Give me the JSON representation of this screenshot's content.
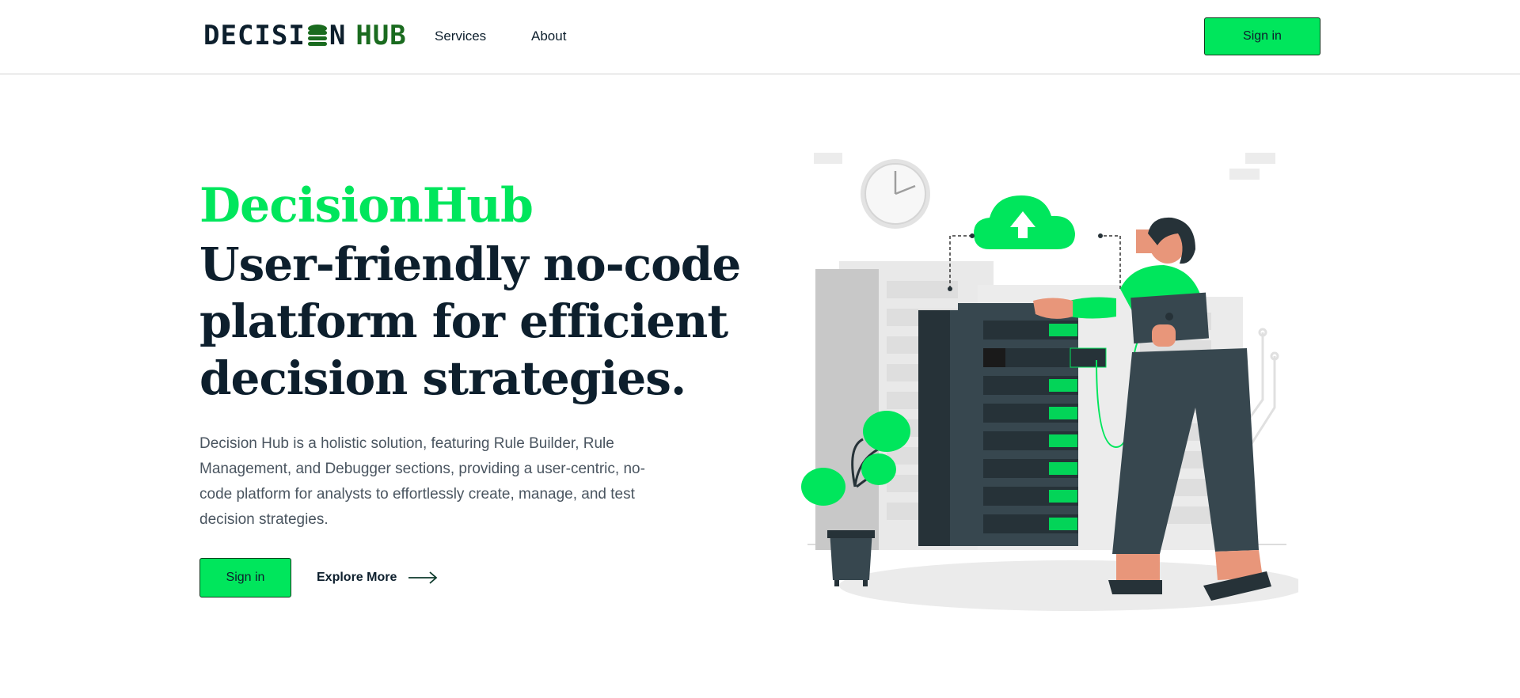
{
  "header": {
    "logo": {
      "part1": "DECISI",
      "part2": "N",
      "part3": "HUB"
    },
    "nav": {
      "services": "Services",
      "about": "About"
    },
    "sign_in": "Sign in"
  },
  "hero": {
    "brand": "DecisionHub",
    "title_lines": [
      "User-friendly no-code",
      "platform for efficient",
      "decision strategies."
    ],
    "description": "Decision Hub is a holistic solution, featuring Rule Builder, Rule Management, and Debugger sections, providing a user-centric, no-code platform for analysts to effortlessly create, manage, and test decision strategies.",
    "sign_in": "Sign in",
    "explore_more": "Explore More"
  },
  "colors": {
    "accent": "#00e65c",
    "brand_dark_green": "#1a6b1f",
    "text_dark": "#0d1f2d",
    "body_text": "#4a5560"
  },
  "icons": {
    "logo_coin": "coin-stack-icon",
    "explore_arrow": "arrow-right-icon"
  }
}
